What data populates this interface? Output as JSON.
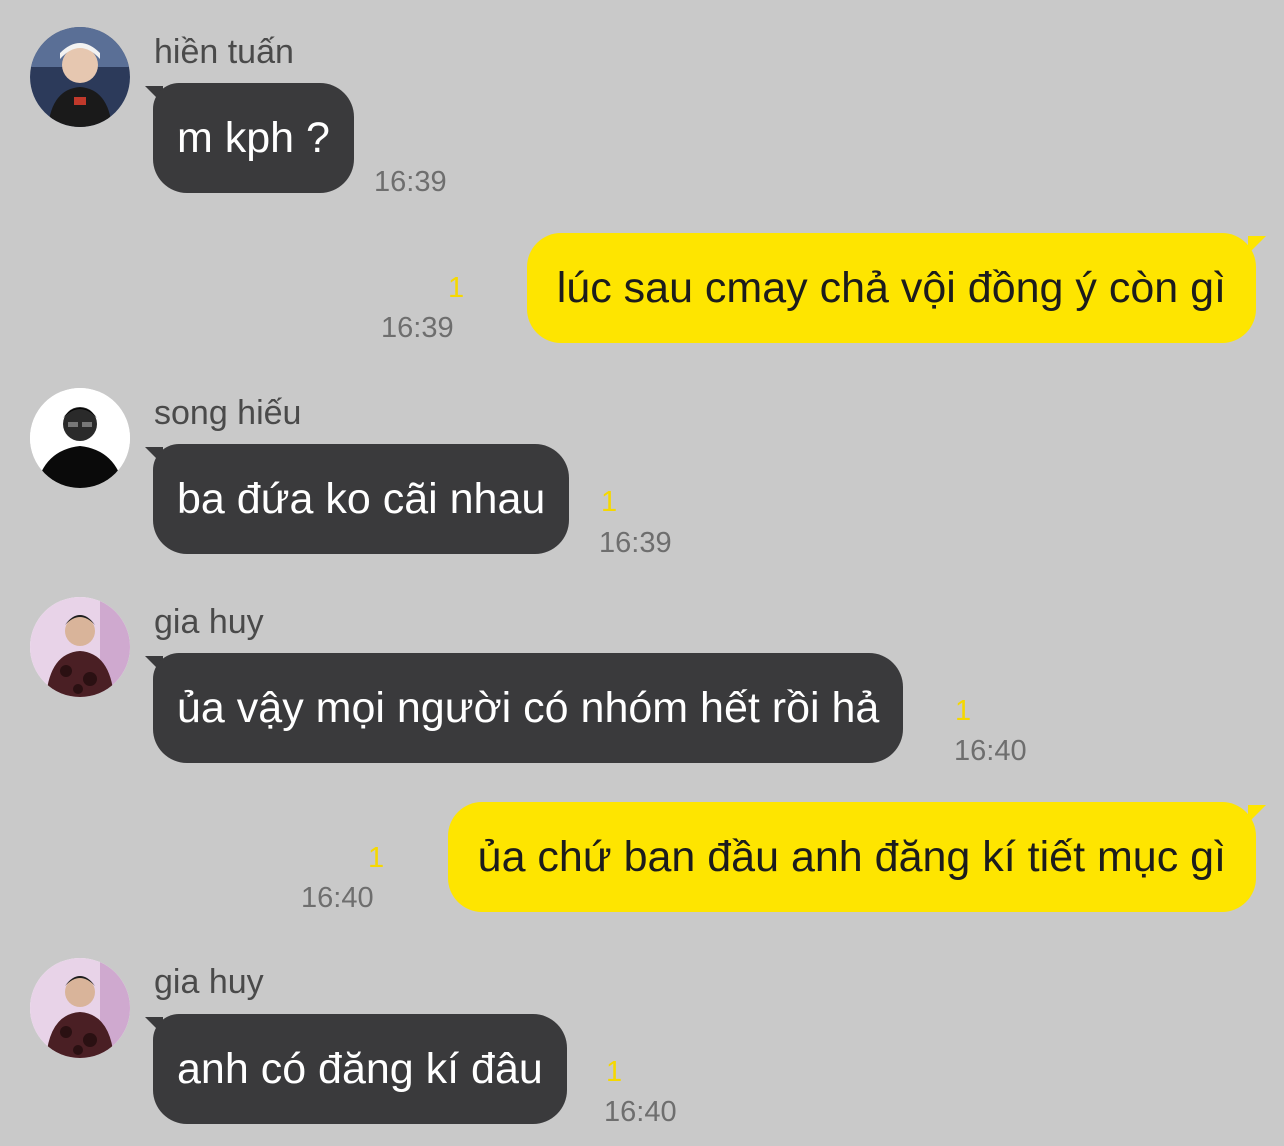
{
  "colors": {
    "background": "#c9c9c9",
    "incoming_bubble": "#3a3a3c",
    "outgoing_bubble": "#fee500",
    "unread_count": "#f5d800",
    "timestamp": "#6e6e6e"
  },
  "messages": [
    {
      "sender": "hiền tuấn",
      "avatar_icon": "profile-photo-icon",
      "text": "m kph ?",
      "time": "16:39",
      "unread": ""
    },
    {
      "sender": "",
      "text": "lúc sau cmay chả vội đồng ý còn gì",
      "time": "16:39",
      "unread": "1"
    },
    {
      "sender": "song hiếu",
      "avatar_icon": "profile-photo-icon",
      "text": "ba đứa ko cãi nhau",
      "time": "16:39",
      "unread": "1"
    },
    {
      "sender": "gia huy",
      "avatar_icon": "profile-photo-icon",
      "text": "ủa vậy mọi người có nhóm hết rồi hả",
      "time": "16:40",
      "unread": "1"
    },
    {
      "sender": "",
      "text": "ủa chứ ban đầu anh đăng kí tiết mục gì",
      "time": "16:40",
      "unread": "1"
    },
    {
      "sender": "gia huy",
      "avatar_icon": "profile-photo-icon",
      "text": "anh có đăng kí đâu",
      "time": "16:40",
      "unread": "1"
    }
  ]
}
